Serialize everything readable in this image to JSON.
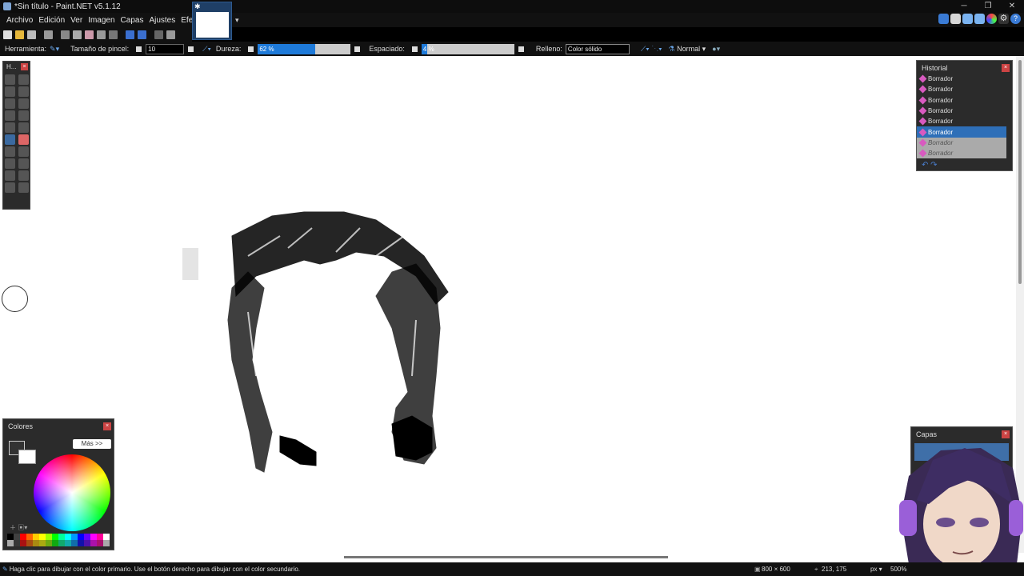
{
  "window": {
    "title": "*Sin título - Paint.NET v5.1.12"
  },
  "menu": [
    "Archivo",
    "Edición",
    "Ver",
    "Imagen",
    "Capas",
    "Ajustes",
    "Efectos"
  ],
  "toolbar": {
    "tool_label": "Herramienta:",
    "brush_size_label": "Tamaño de pincel:",
    "brush_size_value": "10",
    "hardness_label": "Dureza:",
    "hardness_value": "62 %",
    "hardness_fraction": 0.62,
    "spacing_label": "Espaciado:",
    "spacing_value": "4 %",
    "spacing_fraction": 0.04,
    "fill_label": "Relleno:",
    "fill_value": "Color sólido",
    "blend_value": "Normal"
  },
  "tools_panel": {
    "title": "H..."
  },
  "history": {
    "title": "Historial",
    "items": [
      {
        "label": "Borrador",
        "state": "normal"
      },
      {
        "label": "Borrador",
        "state": "normal"
      },
      {
        "label": "Borrador",
        "state": "normal"
      },
      {
        "label": "Borrador",
        "state": "normal"
      },
      {
        "label": "Borrador",
        "state": "normal"
      },
      {
        "label": "Borrador",
        "state": "selected"
      },
      {
        "label": "Borrador",
        "state": "undone"
      },
      {
        "label": "Borrador",
        "state": "undone"
      }
    ]
  },
  "colors": {
    "title": "Colores",
    "more_label": "Más >>",
    "primary": "#333333",
    "secondary": "#ffffff"
  },
  "layers": {
    "title": "Capas"
  },
  "status": {
    "hint": "Haga clic para dibujar con el color primario. Use el botón derecho para dibujar con el color secundario.",
    "image_size": "800 × 600",
    "cursor_pos": "213, 175",
    "unit": "px",
    "zoom": "500%"
  }
}
